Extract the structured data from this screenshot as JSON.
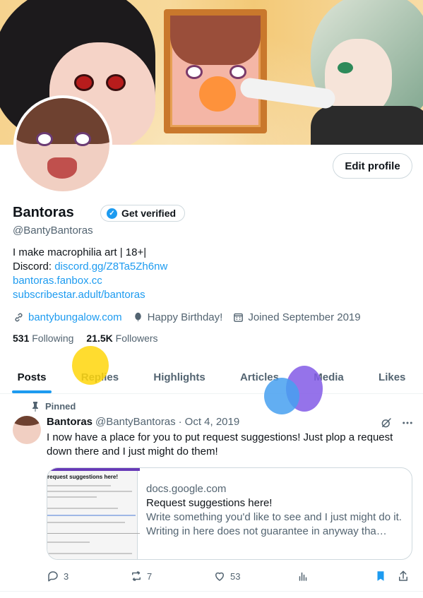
{
  "profile": {
    "edit_label": "Edit profile",
    "display_name": "Bantoras",
    "verify_label": "Get verified",
    "handle": "@BantyBantoras",
    "bio": {
      "line1": "I make macrophilia art | 18+|",
      "discord_prefix": "Discord: ",
      "discord_link": "discord.gg/Z8Ta5Zh6nw",
      "fanbox_link": "bantoras.fanbox.cc",
      "subscribestar_link": "subscribestar.adult/bantoras"
    },
    "meta": {
      "website": "bantybungalow.com",
      "birthday": "Happy Birthday!",
      "joined": "Joined September 2019"
    },
    "following_count": "531",
    "following_label": "Following",
    "followers_count": "21.5K",
    "followers_label": "Followers"
  },
  "tabs": [
    {
      "label": "Posts"
    },
    {
      "label": "Replies"
    },
    {
      "label": "Highlights"
    },
    {
      "label": "Articles"
    },
    {
      "label": "Media"
    },
    {
      "label": "Likes"
    }
  ],
  "tweet": {
    "pinned_label": "Pinned",
    "author": "Bantoras",
    "handle": "@BantyBantoras",
    "separator": "·",
    "date": "Oct 4, 2019",
    "text": "I now have a place for you to put request suggestions! Just plop a request down there and I just might do them!",
    "card": {
      "thumb_title": "request suggestions here!",
      "domain": "docs.google.com",
      "title": "Request suggestions here!",
      "description": "Write something you'd like to see and I just might do it. Writing in here does not guarantee in anyway tha…"
    },
    "stats": {
      "replies": "3",
      "reposts": "7",
      "likes": "53"
    }
  },
  "colors": {
    "accent": "#1d9bf0",
    "text": "#0f1419",
    "muted": "#536471"
  }
}
